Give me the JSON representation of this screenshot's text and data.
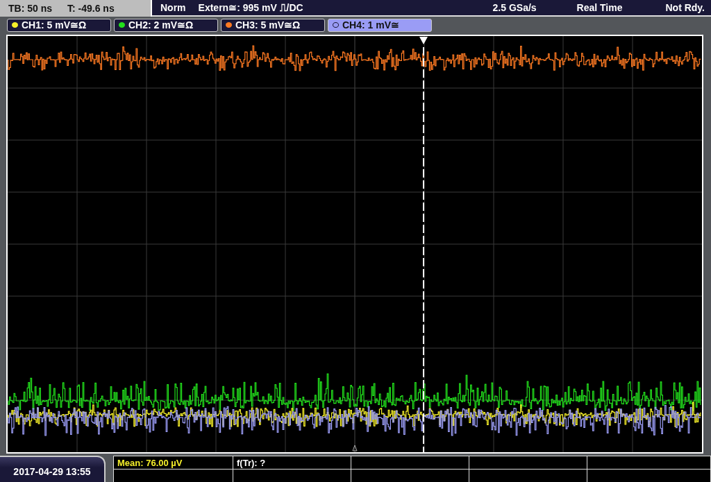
{
  "status_bar": {
    "timebase": "TB: 50 ns",
    "trigger_time": "T: -49.6 ns",
    "trigger_mode": "Norm",
    "trigger_source": "Extern≅: 995 mV ⎍/DC",
    "sample_rate": "2.5 GSa/s",
    "acquisition_mode": "Real Time",
    "state": "Not Rdy."
  },
  "channels": [
    {
      "label": "CH1: 5 mV≅Ω",
      "color": "#f5ef2a",
      "selected": false
    },
    {
      "label": "CH2: 2 mV≅Ω",
      "color": "#22e01c",
      "selected": false
    },
    {
      "label": "CH3: 5 mV≅Ω",
      "color": "#ff7a22",
      "selected": false
    },
    {
      "label": "CH4: 1 mV≅",
      "color": "#9a9cf5",
      "selected": true
    }
  ],
  "date_time": "2017-04-29 13:55",
  "measurements": [
    {
      "text": "Mean: 76.00 µV",
      "kind": "channel"
    },
    {
      "text": "f(Tr): ?",
      "kind": "plain"
    }
  ]
}
